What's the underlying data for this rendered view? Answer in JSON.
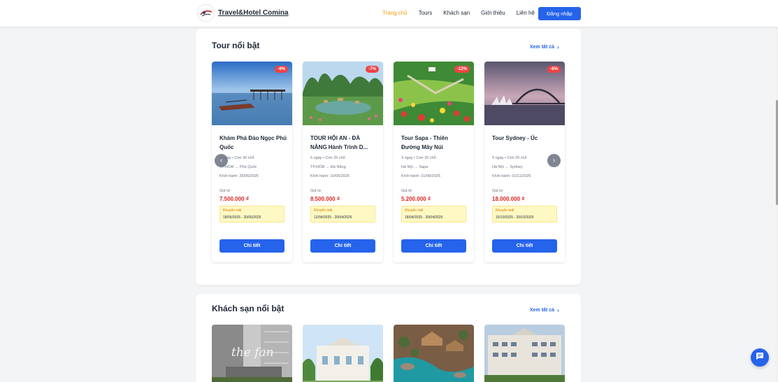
{
  "header": {
    "logo_text": "Travel&Hotel Comina",
    "nav": [
      {
        "label": "Trang chủ",
        "active": true
      },
      {
        "label": "Tours",
        "active": false
      },
      {
        "label": "Khách sạn",
        "active": false
      },
      {
        "label": "Giới thiệu",
        "active": false
      },
      {
        "label": "Liên hệ",
        "active": false
      }
    ],
    "login_label": "Đăng nhập"
  },
  "tours": {
    "title": "Tour nổi bật",
    "see_all": "Xem tất cả",
    "cards": [
      {
        "discount": "-9%",
        "title": "Khám Phá Đảo Ngọc Phú Quốc",
        "duration": "4 ngày",
        "seats": "Còn 30 chỗ",
        "route_from": "TP.HCM",
        "route_to": "Phú Quốc",
        "departure": "Khởi hành: 25/06/2025",
        "price_label": "Giá từ",
        "price": "7.500.000 ₫",
        "promo_label": "Khuyến mãi",
        "promo_dates": "18/05/2025 - 20/05/2025",
        "button": "Chi tiết"
      },
      {
        "discount": "-7%",
        "title": "TOUR HỘI AN - ĐÀ NẴNG Hành Trình D...",
        "duration": "5 ngày",
        "seats": "Còn 25 chỗ",
        "route_from": "TP.HCM",
        "route_to": "Đà Nẵng",
        "departure": "Khởi hành: 10/06/2025",
        "price_label": "Giá từ",
        "price": "8.500.000 ₫",
        "promo_label": "Khuyến mãi",
        "promo_dates": "12/04/2025 - 20/04/2025",
        "button": "Chi tiết"
      },
      {
        "discount": "-13%",
        "title": "Tour Sapa - Thiên Đường Mây Núi",
        "duration": "3 ngày",
        "seats": "Còn 20 chỗ",
        "route_from": "Hà Nội",
        "route_to": "Sapa",
        "departure": "Khởi hành: 01/08/2025",
        "price_label": "Giá từ",
        "price": "5.200.000 ₫",
        "promo_label": "Khuyến mãi",
        "promo_dates": "18/04/2025 - 20/04/2025",
        "button": "Chi tiết"
      },
      {
        "discount": "-6%",
        "title": "Tour Sydney - Úc",
        "duration": "5 ngày",
        "seats": "Còn 20 chỗ",
        "route_from": "Hà Nội",
        "route_to": "Sydney",
        "departure": "Khởi hành: 01/11/2025",
        "price_label": "Giá từ",
        "price": "18.000.000 ₫",
        "promo_label": "Khuyến mãi",
        "promo_dates": "15/10/2025 - 20/10/2025",
        "button": "Chi tiết"
      }
    ]
  },
  "hotels": {
    "title": "Khách sạn nổi bật",
    "see_all": "Xem tất cả",
    "image_text": "the fan"
  },
  "icons": {
    "prev": "chevron-left-icon",
    "next": "chevron-right-icon",
    "chat": "chat-icon",
    "arrow": "→"
  },
  "colors": {
    "primary": "#2563eb",
    "active_nav": "#f59e0b",
    "price": "#dc2626",
    "badge": "#ef4444",
    "promo_bg": "#fef9c3"
  }
}
